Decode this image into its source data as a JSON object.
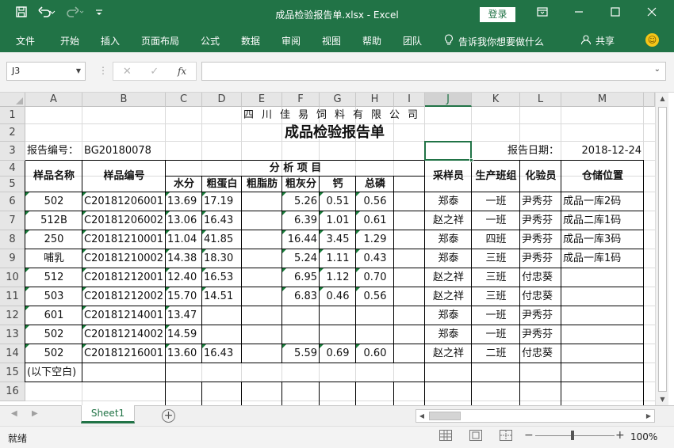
{
  "app": {
    "title": "成品检验报告单.xlsx  -  Excel",
    "login": "登录",
    "qat_icons": [
      "save-icon",
      "undo-icon",
      "redo-icon",
      "customize-icon"
    ],
    "window_icons": [
      "ribbon-display-icon",
      "minimize-icon",
      "maximize-icon",
      "close-icon"
    ]
  },
  "ribbon": {
    "tabs": [
      "文件",
      "开始",
      "插入",
      "页面布局",
      "公式",
      "数据",
      "审阅",
      "视图",
      "帮助",
      "团队"
    ],
    "tell_me": "告诉我你想要做什么",
    "share": "共享"
  },
  "formula_bar": {
    "name_box": "J3",
    "fx": "fx",
    "value": ""
  },
  "columns": [
    "A",
    "B",
    "C",
    "D",
    "E",
    "F",
    "G",
    "H",
    "I",
    "J",
    "K",
    "L",
    "M"
  ],
  "selected_column": "J",
  "rows": [
    "1",
    "2",
    "3",
    "4",
    "5",
    "6",
    "7",
    "8",
    "9",
    "10",
    "11",
    "12",
    "13",
    "14",
    "15",
    "16"
  ],
  "sheet": {
    "company": "四川佳易饲料有限公司",
    "title": "成品检验报告单",
    "report_no_label": "报告编号：",
    "report_no": "BG20180078",
    "report_date_label": "报告日期：",
    "report_date": "2018-12-24",
    "headers": {
      "sample_name": "样品名称",
      "sample_no": "样品编号",
      "analysis": "分  析  项  目",
      "moisture": "水分",
      "protein": "粗蛋白",
      "fat": "粗脂肪",
      "ash": "粗灰分",
      "calcium": "钙",
      "phosphorus": "总磷",
      "sampler": "采样员",
      "team": "生产班组",
      "inspector": "化验员",
      "storage": "仓储位置"
    },
    "data_rows": [
      [
        "502",
        "C20181206001",
        "13.69",
        "17.19",
        "",
        "5.26",
        "0.51",
        "0.56",
        "",
        "郑泰",
        "一班",
        "尹秀芬",
        "成品一库2码"
      ],
      [
        "512B",
        "C20181206002",
        "13.06",
        "16.43",
        "",
        "6.39",
        "1.01",
        "0.61",
        "",
        "赵之祥",
        "一班",
        "尹秀芬",
        "成品二库1码"
      ],
      [
        "250",
        "C20181210001",
        "11.04",
        "41.85",
        "",
        "16.44",
        "3.45",
        "1.29",
        "",
        "郑泰",
        "四班",
        "尹秀芬",
        "成品一库3码"
      ],
      [
        "哺乳",
        "C20181210002",
        "14.38",
        "18.30",
        "",
        "5.24",
        "1.11",
        "0.43",
        "",
        "郑泰",
        "三班",
        "尹秀芬",
        "成品一库1码"
      ],
      [
        "512",
        "C20181212001",
        "12.40",
        "16.53",
        "",
        "6.95",
        "1.12",
        "0.70",
        "",
        "赵之祥",
        "三班",
        "付忠葵",
        ""
      ],
      [
        "503",
        "C20181212002",
        "15.70",
        "14.51",
        "",
        "6.83",
        "0.46",
        "0.56",
        "",
        "赵之祥",
        "三班",
        "付忠葵",
        ""
      ],
      [
        "601",
        "C20181214001",
        "13.47",
        "",
        "",
        "",
        "",
        "",
        "",
        "郑泰",
        "一班",
        "尹秀芬",
        ""
      ],
      [
        "502",
        "C20181214002",
        "14.59",
        "",
        "",
        "",
        "",
        "",
        "",
        "郑泰",
        "一班",
        "尹秀芬",
        ""
      ],
      [
        "502",
        "C20181216001",
        "13.60",
        "16.43",
        "",
        "5.59",
        "0.69",
        "0.60",
        "",
        "赵之祥",
        "二班",
        "付忠葵",
        ""
      ]
    ],
    "blank_note": "(以下空白)"
  },
  "sheet_tabs": [
    "Sheet1"
  ],
  "status": {
    "ready": "就绪",
    "zoom": "100%"
  },
  "colors": {
    "accent": "#217346",
    "error_triangle": "#1a7f3c"
  }
}
